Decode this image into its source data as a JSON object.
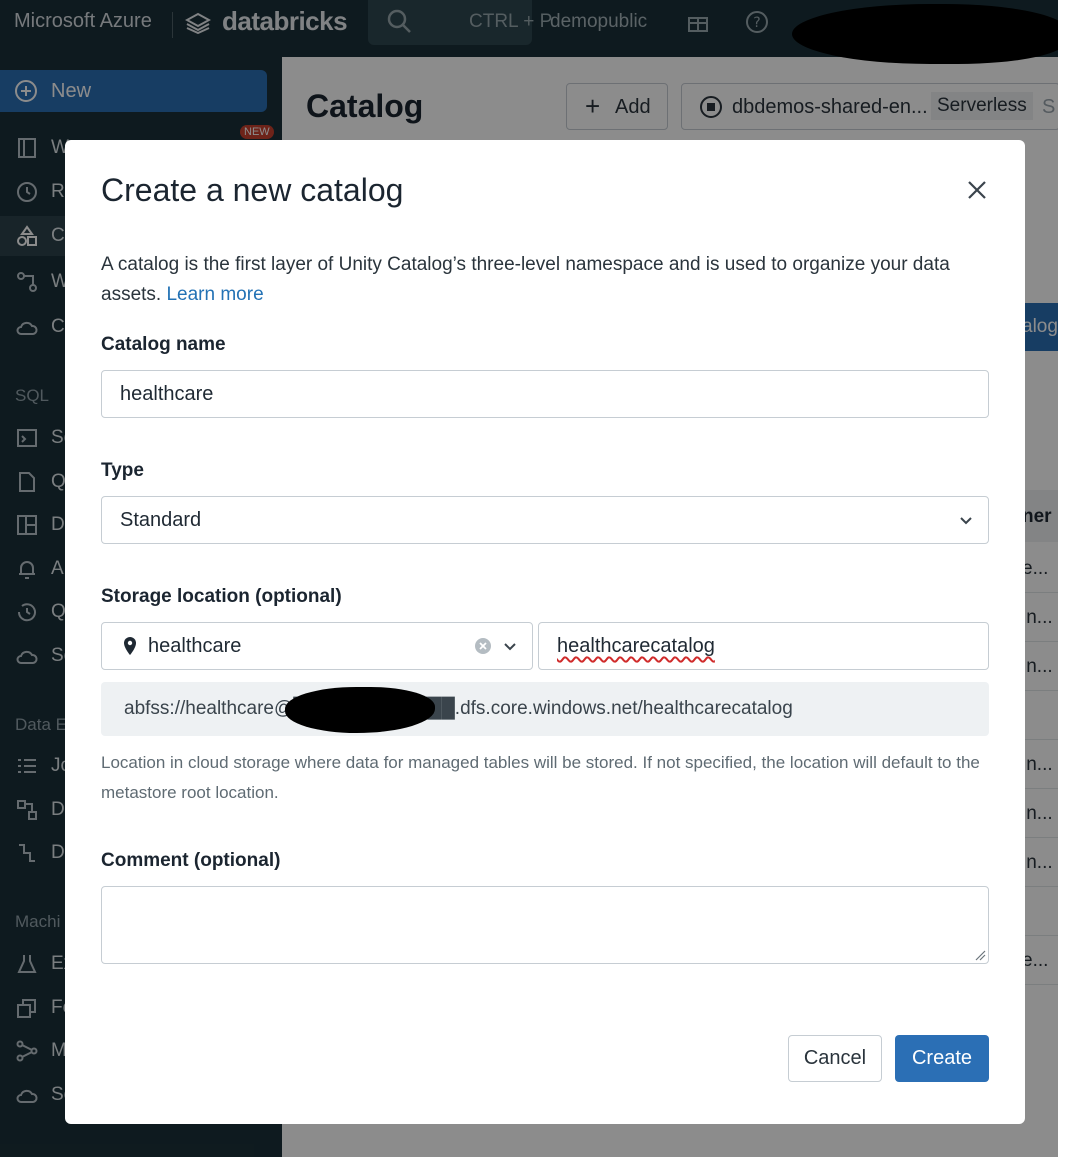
{
  "topbar": {
    "brand": "Microsoft Azure",
    "product": "databricks",
    "search_shortcut": "CTRL + P",
    "workspace": "demopublic"
  },
  "sidebar": {
    "new_label": "New",
    "new_badge": "NEW",
    "items": [
      {
        "label": "W",
        "icon": "workspace-icon"
      },
      {
        "label": "Re",
        "icon": "recents-icon"
      },
      {
        "label": "Ca",
        "icon": "catalog-icon"
      },
      {
        "label": "W",
        "icon": "workflows-icon"
      },
      {
        "label": "Co",
        "icon": "compute-icon"
      },
      {
        "label": "Se",
        "icon": "sql-editor-icon"
      },
      {
        "label": "Q",
        "icon": "queries-icon"
      },
      {
        "label": "D",
        "icon": "dashboards-icon"
      },
      {
        "label": "A",
        "icon": "alerts-icon"
      },
      {
        "label": "Q",
        "icon": "query-history-icon"
      },
      {
        "label": "Se",
        "icon": "sql-warehouses-icon"
      },
      {
        "label": "Jo",
        "icon": "jobs-icon"
      },
      {
        "label": "D",
        "icon": "data-ingestion-icon"
      },
      {
        "label": "D",
        "icon": "delta-live-tables-icon"
      },
      {
        "label": "Ex",
        "icon": "experiments-icon"
      },
      {
        "label": "Fe",
        "icon": "features-icon"
      },
      {
        "label": "M",
        "icon": "models-icon"
      },
      {
        "label": "Se",
        "icon": "serving-icon"
      }
    ],
    "sections": [
      "SQL",
      "Data E",
      "Machi"
    ]
  },
  "main": {
    "title": "Catalog",
    "add_label": "Add",
    "compute_label": "dbdemos-shared-en...",
    "compute_tag": "Serverless",
    "compute_more": "S",
    "right_button": "alog",
    "right_header": "ner",
    "right_rows": [
      "e...",
      "in...",
      "in...",
      "",
      "in...",
      "in...",
      "in...",
      "",
      "e..."
    ]
  },
  "modal": {
    "title": "Create a new catalog",
    "description": "A catalog is the first layer of Unity Catalog’s three-level namespace and is used to organize your data assets.",
    "learn_more": "Learn more",
    "catalog_name_label": "Catalog name",
    "catalog_name_value": "healthcare",
    "type_label": "Type",
    "type_value": "Standard",
    "storage_label": "Storage location (optional)",
    "storage_location_value": "healthcare",
    "storage_path_value": "healthcarecatalog",
    "full_path": "abfss://healthcare@████████████.dfs.core.windows.net/healthcarecatalog",
    "help_text": "Location in cloud storage where data for managed tables will be stored. If not specified, the location will default to the metastore root location.",
    "comment_label": "Comment (optional)",
    "comment_value": "",
    "cancel_label": "Cancel",
    "create_label": "Create"
  }
}
